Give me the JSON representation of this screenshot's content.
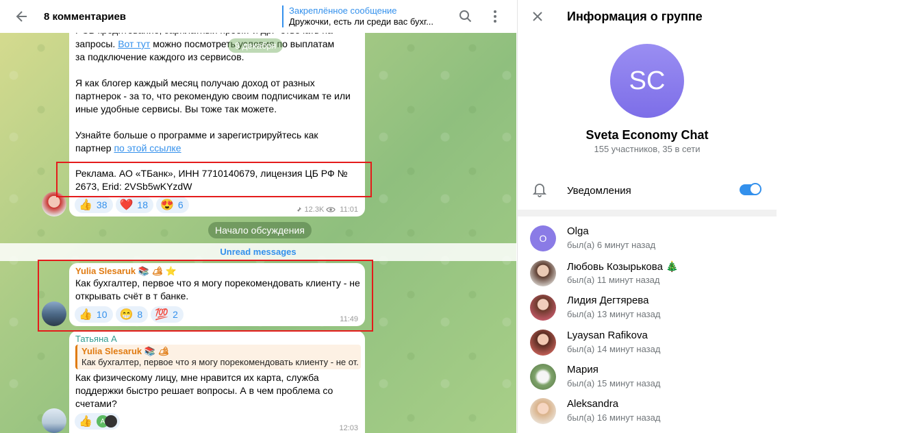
{
  "header": {
    "title": "8 комментариев",
    "pinned_label": "Закреплённое сообщение",
    "pinned_text": "Дружочки, есть ли среди вас бухг..."
  },
  "post": {
    "top_fragment_a": "PCB кредитование, зарплатный проект и др.\" отвечать на",
    "top_fragment_b": "запросы.",
    "link1": "Вот тут",
    "line2_rest": "можно посмотреть условия по выплатам",
    "line3": "за подключение каждого из сервисов.",
    "para2": "Я как блогер каждый месяц получаю доход от разных партнерок - за то, что рекомендую своим подписчикам те или иные удобные сервисы. Вы тоже так можете.",
    "para3_start": "Узнайте больше о программе и зарегистрируйтесь как партнер",
    "link2": "по этой ссылке",
    "ad": "Реклама. АО «ТБанк», ИНН 7710140679, лицензия ЦБ РФ № 2673, Erid: 2VSb5wKYzdW",
    "reactions": [
      {
        "emoji": "👍",
        "count": "38"
      },
      {
        "emoji": "❤️",
        "count": "18"
      },
      {
        "emoji": "😍",
        "count": "6"
      }
    ],
    "views": "12.3K",
    "time": "11:01"
  },
  "floating_pill": "9 декабря",
  "discussion_start": "Начало обсуждения",
  "unread_label": "Unread messages",
  "msg1": {
    "author": "Yulia Slesaruk 📚 🏕 ⭐",
    "text": "Как бухгалтер, первое что я могу порекомендовать клиенту - не открывать счёт в т банке.",
    "reactions": [
      {
        "emoji": "👍",
        "count": "10"
      },
      {
        "emoji": "😁",
        "count": "8"
      },
      {
        "emoji": "💯",
        "count": "2"
      }
    ],
    "time": "11:49"
  },
  "msg2": {
    "author": "Татьяна А",
    "reply_author": "Yulia Slesaruk 📚 🏕",
    "reply_text": "Как бухгалтер, первое что я могу порекомендовать клиенту - не от...",
    "text": "Как физическому лицу, мне нравится их карта, служба поддержки быстро решает вопросы. А в чем проблема со счетами?",
    "reaction_emoji": "👍",
    "reaction_avatar_letter": "A",
    "time": "12:03"
  },
  "panel": {
    "title": "Информация о группе",
    "avatar_initials": "SC",
    "group_name": "Sveta Economy Chat",
    "group_sub": "155 участников, 35 в сети",
    "notifications_label": "Уведомления",
    "members": [
      {
        "name": "Olga",
        "status": "был(а) 6 минут назад",
        "initial": "O",
        "color": "#8a7be6"
      },
      {
        "name": "Любовь Козырькова 🎄",
        "status": "был(а) 11 минут назад",
        "initial": "",
        "color": "#7a5f52"
      },
      {
        "name": "Лидия Дегтярева",
        "status": "был(а) 13 минут назад",
        "initial": "",
        "color": "#c65a6a"
      },
      {
        "name": "Lyaysan Rafikova",
        "status": "был(а) 14 минут назад",
        "initial": "",
        "color": "#c8625a"
      },
      {
        "name": "Мария",
        "status": "был(а) 15 минут назад",
        "initial": "",
        "color": "#7fa36b"
      },
      {
        "name": "Aleksandra",
        "status": "был(а) 16 минут назад",
        "initial": "",
        "color": "#d9b28a"
      }
    ]
  },
  "colors": {
    "accent": "#3390ec",
    "author_orange": "#e07b12",
    "author_teal": "#2f9b8f",
    "highlight_box": "#e41b1b"
  }
}
